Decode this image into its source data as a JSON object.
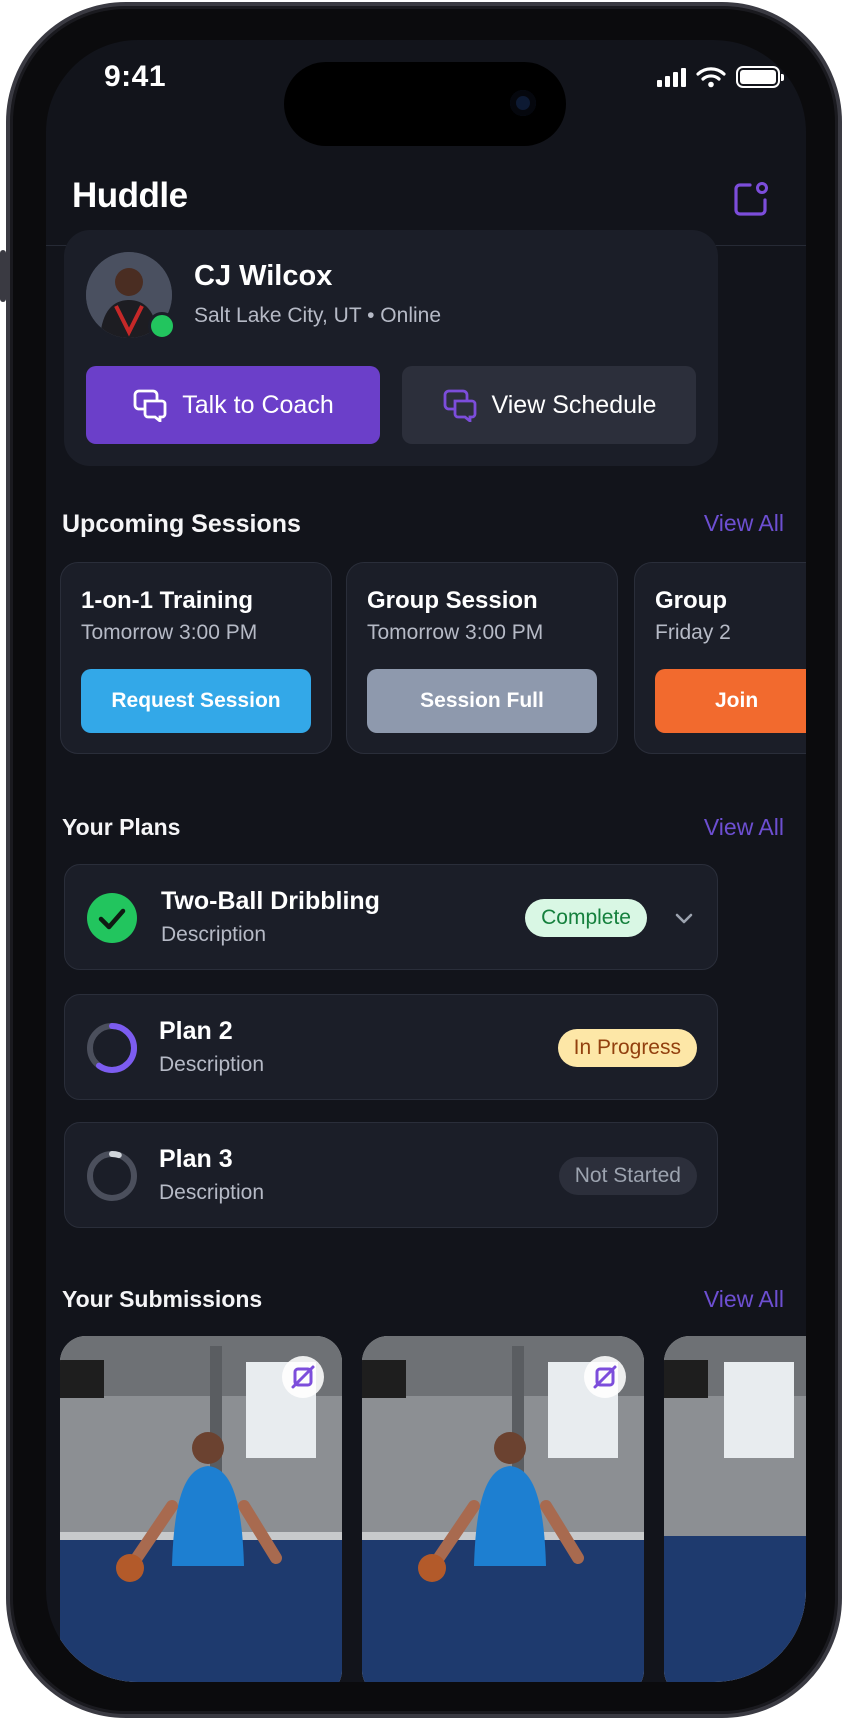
{
  "status_bar": {
    "time": "9:41"
  },
  "header": {
    "title": "Huddle"
  },
  "profile": {
    "name": "CJ Wilcox",
    "location_status": "Salt Lake City, UT • Online",
    "talk_to_coach_label": "Talk to Coach",
    "view_schedule_label": "View Schedule"
  },
  "upcoming_sessions": {
    "title": "Upcoming Sessions",
    "view_all_label": "View All",
    "cards": [
      {
        "title": "1-on-1 Training",
        "time": "Tomorrow 3:00 PM",
        "action_label": "Request Session",
        "action_color": "#33a8e8"
      },
      {
        "title": "Group Session",
        "time": "Tomorrow 3:00 PM",
        "action_label": "Session Full",
        "action_color": "#8e99ad"
      },
      {
        "title": "Group",
        "time": "Friday 2",
        "action_label": "Join",
        "action_color": "#f26a2e"
      }
    ]
  },
  "plans": {
    "title": "Your Plans",
    "view_all_label": "View All",
    "items": [
      {
        "name": "Two-Ball Dribbling",
        "description": "Description",
        "status": "Complete",
        "progress": 1.0
      },
      {
        "name": "Plan 2",
        "description": "Description",
        "status": "In Progress",
        "progress": 0.6
      },
      {
        "name": "Plan 3",
        "description": "Description",
        "status": "Not Started",
        "progress": 0.05
      }
    ]
  },
  "submissions": {
    "title": "Your Submissions",
    "view_all_label": "View All"
  },
  "colors": {
    "accent": "#6b3fc9",
    "complete": "#22c55e",
    "in_progress": "#7c5cf0",
    "background": "#12141b",
    "card": "#1b1e28"
  }
}
